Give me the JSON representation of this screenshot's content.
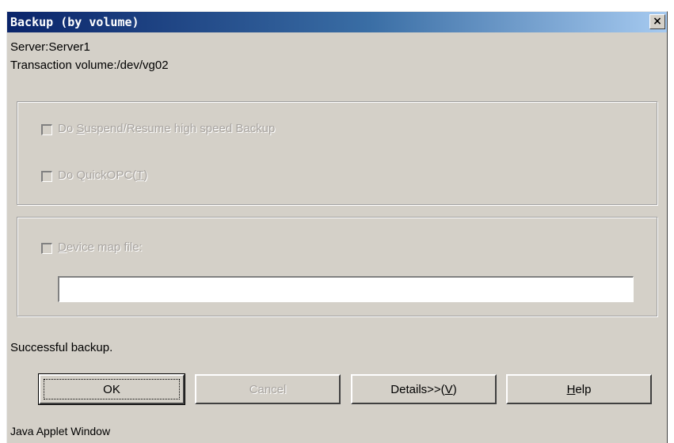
{
  "window": {
    "title": "Backup (by volume)",
    "close_glyph": "×"
  },
  "info": {
    "server": "Server:Server1",
    "transaction_volume": "Transaction volume:/dev/vg02"
  },
  "options": {
    "suspend_pre": "Do ",
    "suspend_mnemonic": "S",
    "suspend_post": "uspend/Resume high speed Backup",
    "quickopc_pre": "Do QuickOPC(",
    "quickopc_mnemonic": "T",
    "quickopc_post": ")"
  },
  "device_map": {
    "label_mnemonic": "D",
    "label_rest": "evice map file:",
    "value": ""
  },
  "status": "Successful backup.",
  "buttons": {
    "ok": "OK",
    "cancel": "Cancel",
    "details_pre": "Details>>(",
    "details_mnemonic": "V",
    "details_post": ")",
    "help_mnemonic": "H",
    "help_rest": "elp"
  },
  "footer": "Java Applet Window",
  "colors": {
    "title_start": "#0a246a",
    "title_end": "#a6caf0",
    "face": "#d4d0c8",
    "disabled_text": "#a8a4a0"
  }
}
